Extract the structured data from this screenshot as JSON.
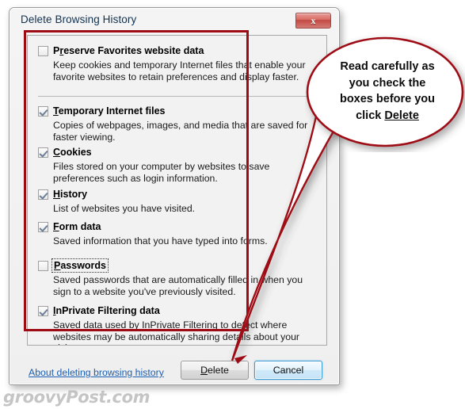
{
  "window": {
    "title": "Delete Browsing History",
    "close_label": "x"
  },
  "options": [
    {
      "label_pre": "P",
      "label_underlined": "r",
      "label_post": "eserve Favorites website data",
      "checked": false,
      "focused": false,
      "description": "Keep cookies and temporary Internet files that enable your favorite websites to retain preferences and display faster."
    },
    {
      "label_pre": "",
      "label_underlined": "T",
      "label_post": "emporary Internet files",
      "checked": true,
      "focused": false,
      "description": "Copies of webpages, images, and media that are saved for faster viewing."
    },
    {
      "label_pre": "",
      "label_underlined": "C",
      "label_post": "ookies",
      "checked": true,
      "focused": false,
      "description": "Files stored on your computer by websites to save preferences such as login information."
    },
    {
      "label_pre": "",
      "label_underlined": "H",
      "label_post": "istory",
      "checked": true,
      "focused": false,
      "description": "List of websites you have visited."
    },
    {
      "label_pre": "",
      "label_underlined": "F",
      "label_post": "orm data",
      "checked": true,
      "focused": false,
      "description": "Saved information that you have typed into forms."
    },
    {
      "label_pre": "",
      "label_underlined": "P",
      "label_post": "asswords",
      "checked": false,
      "focused": true,
      "description": "Saved passwords that are automatically filled in when you sign to a website you've previously visited."
    },
    {
      "label_pre": "",
      "label_underlined": "I",
      "label_post": "nPrivate Filtering data",
      "checked": true,
      "focused": false,
      "description": "Saved data used by InPrivate Filtering to detect where websites may be automatically sharing details about your visit."
    }
  ],
  "footer": {
    "about_link": "About deleting browsing history",
    "delete_pre": "",
    "delete_underlined": "D",
    "delete_post": "elete",
    "cancel_label": "Cancel"
  },
  "callout": {
    "line1": "Read carefully as",
    "line2": "you check the",
    "line3": "boxes before you",
    "line4_pre": "click ",
    "line4_underlined": "Delete"
  },
  "watermark": {
    "text": "groovyPost.com"
  },
  "colors": {
    "highlight_red": "#9e0b14",
    "title_text": "#12314f",
    "link_blue": "#1a5fb4",
    "cancel_border": "#3c9ad4"
  }
}
